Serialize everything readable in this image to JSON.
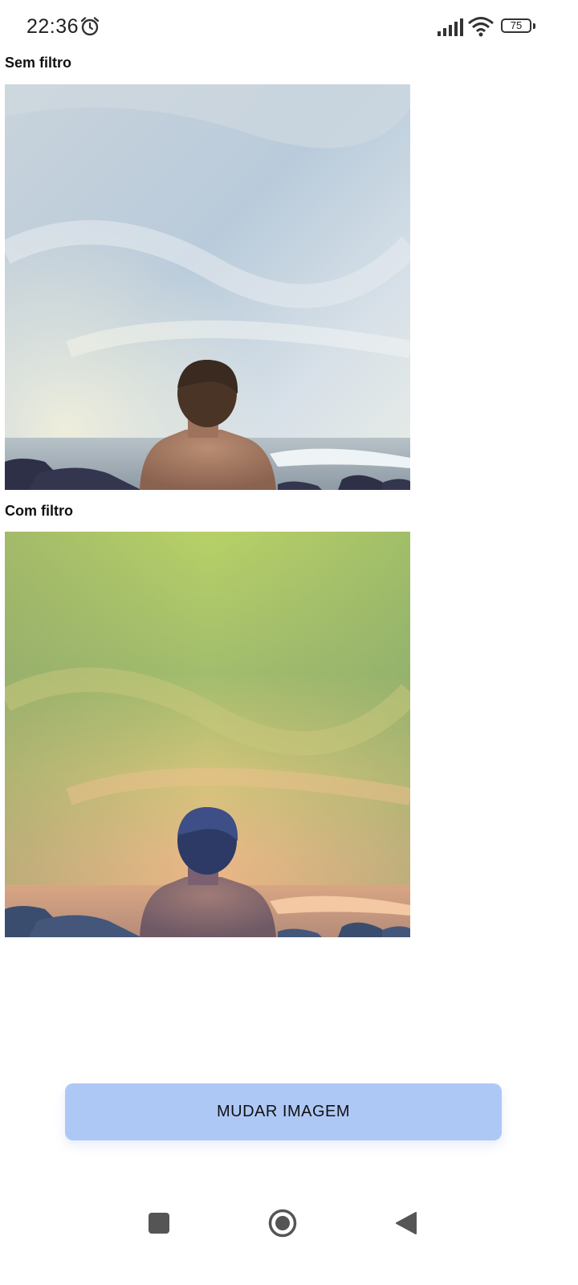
{
  "status_bar": {
    "time": "22:36",
    "battery": "75",
    "icons": [
      "alarm-icon",
      "signal-icon",
      "wifi-icon",
      "battery-icon"
    ]
  },
  "labels": {
    "no_filter": "Sem filtro",
    "with_filter": "Com filtro"
  },
  "images": {
    "original": "photo of man facing the sea under cloudy sky",
    "filtered": "same photo with green-yellow-orange color filter"
  },
  "button": {
    "label": "MUDAR IMAGEM",
    "color": "#aec8f6"
  },
  "nav_bar": {
    "icons": [
      "recents-square-icon",
      "home-circle-icon",
      "back-triangle-icon"
    ]
  }
}
